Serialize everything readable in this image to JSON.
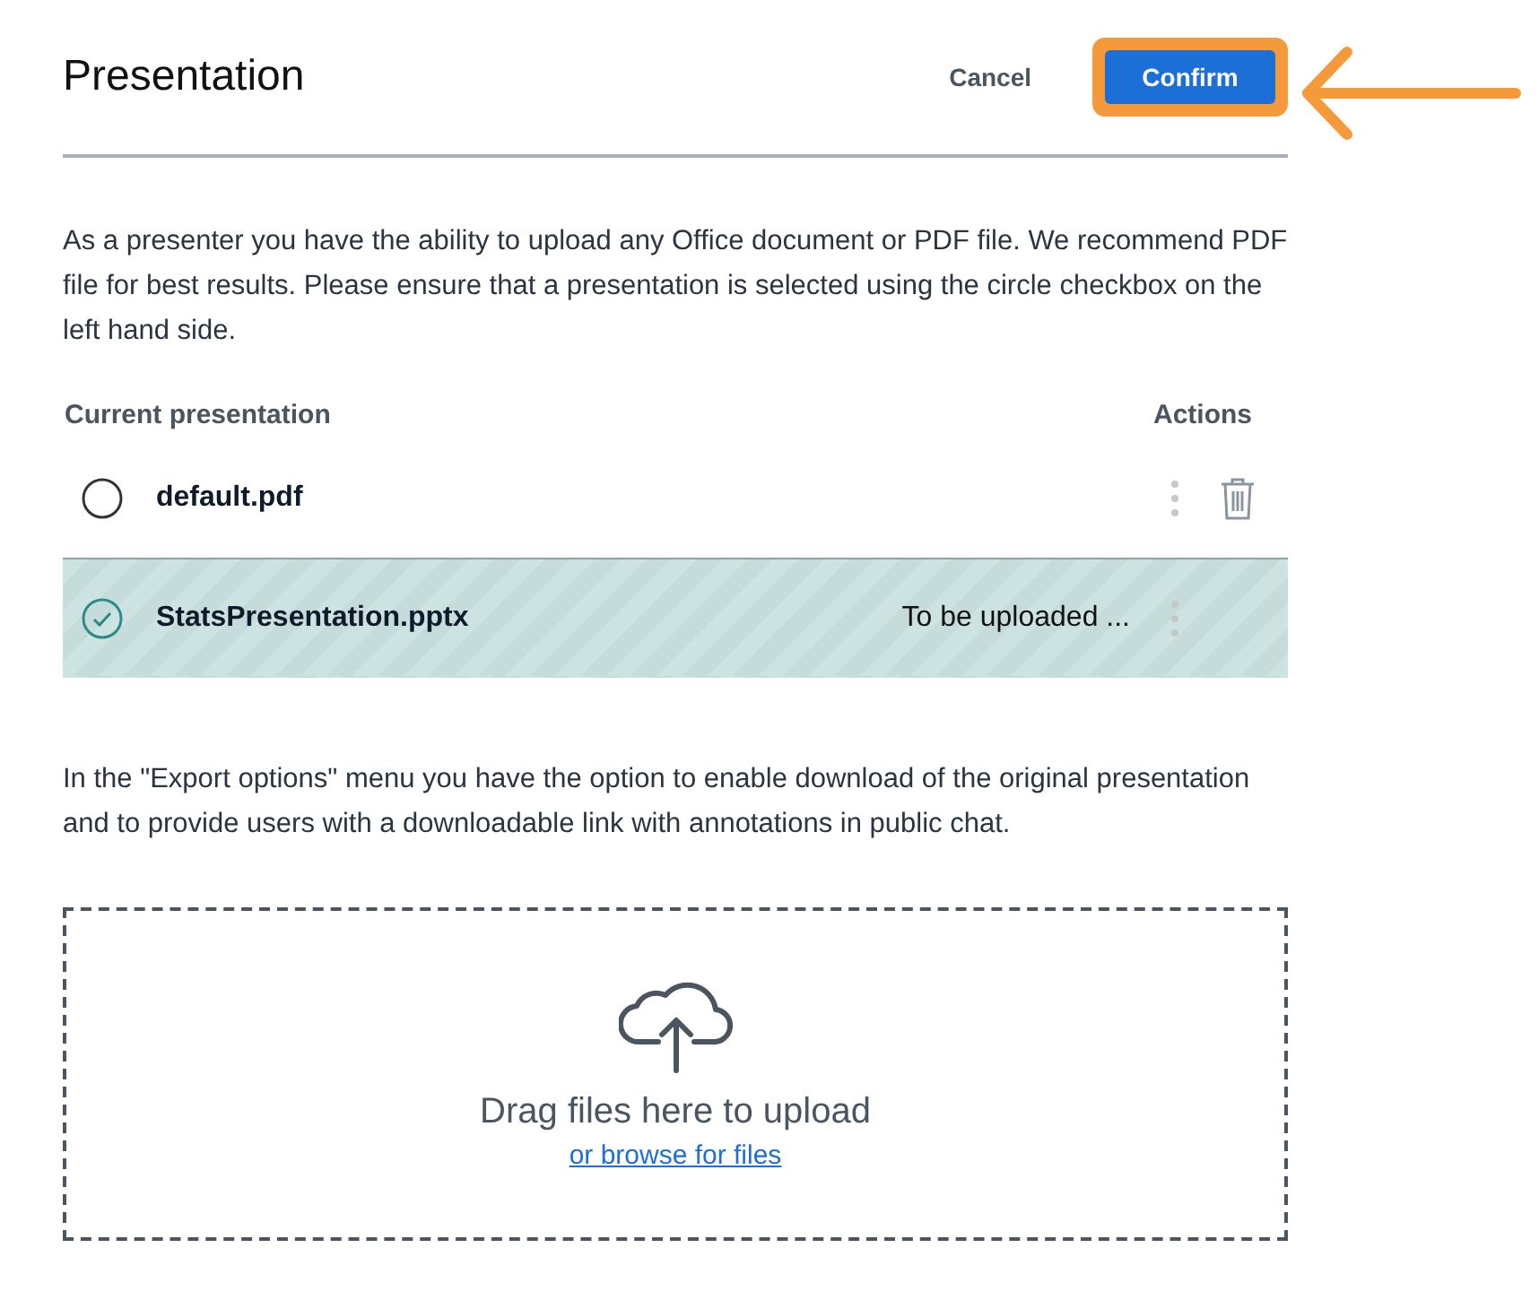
{
  "header": {
    "title": "Presentation",
    "cancel": "Cancel",
    "confirm": "Confirm",
    "confirm_highlighted": true
  },
  "intro": "As a presenter you have the ability to upload any Office document or PDF file. We recommend PDF file for best results. Please ensure that a presentation is selected using the circle checkbox on the left hand side.",
  "table": {
    "columns": [
      "Current presentation",
      "Actions"
    ],
    "rows": [
      {
        "name": "default.pdf",
        "selected": false,
        "deletable": true
      },
      {
        "name": "StatsPresentation.pptx",
        "selected": true,
        "status": "To be uploaded ...",
        "deletable": false
      }
    ]
  },
  "export_note": "In the \"Export options\" menu you have the option to enable download of the original presentation and to provide users with a downloadable link with annotations in public chat.",
  "dropzone": {
    "title": "Drag files here to upload",
    "link": "or browse for files"
  }
}
